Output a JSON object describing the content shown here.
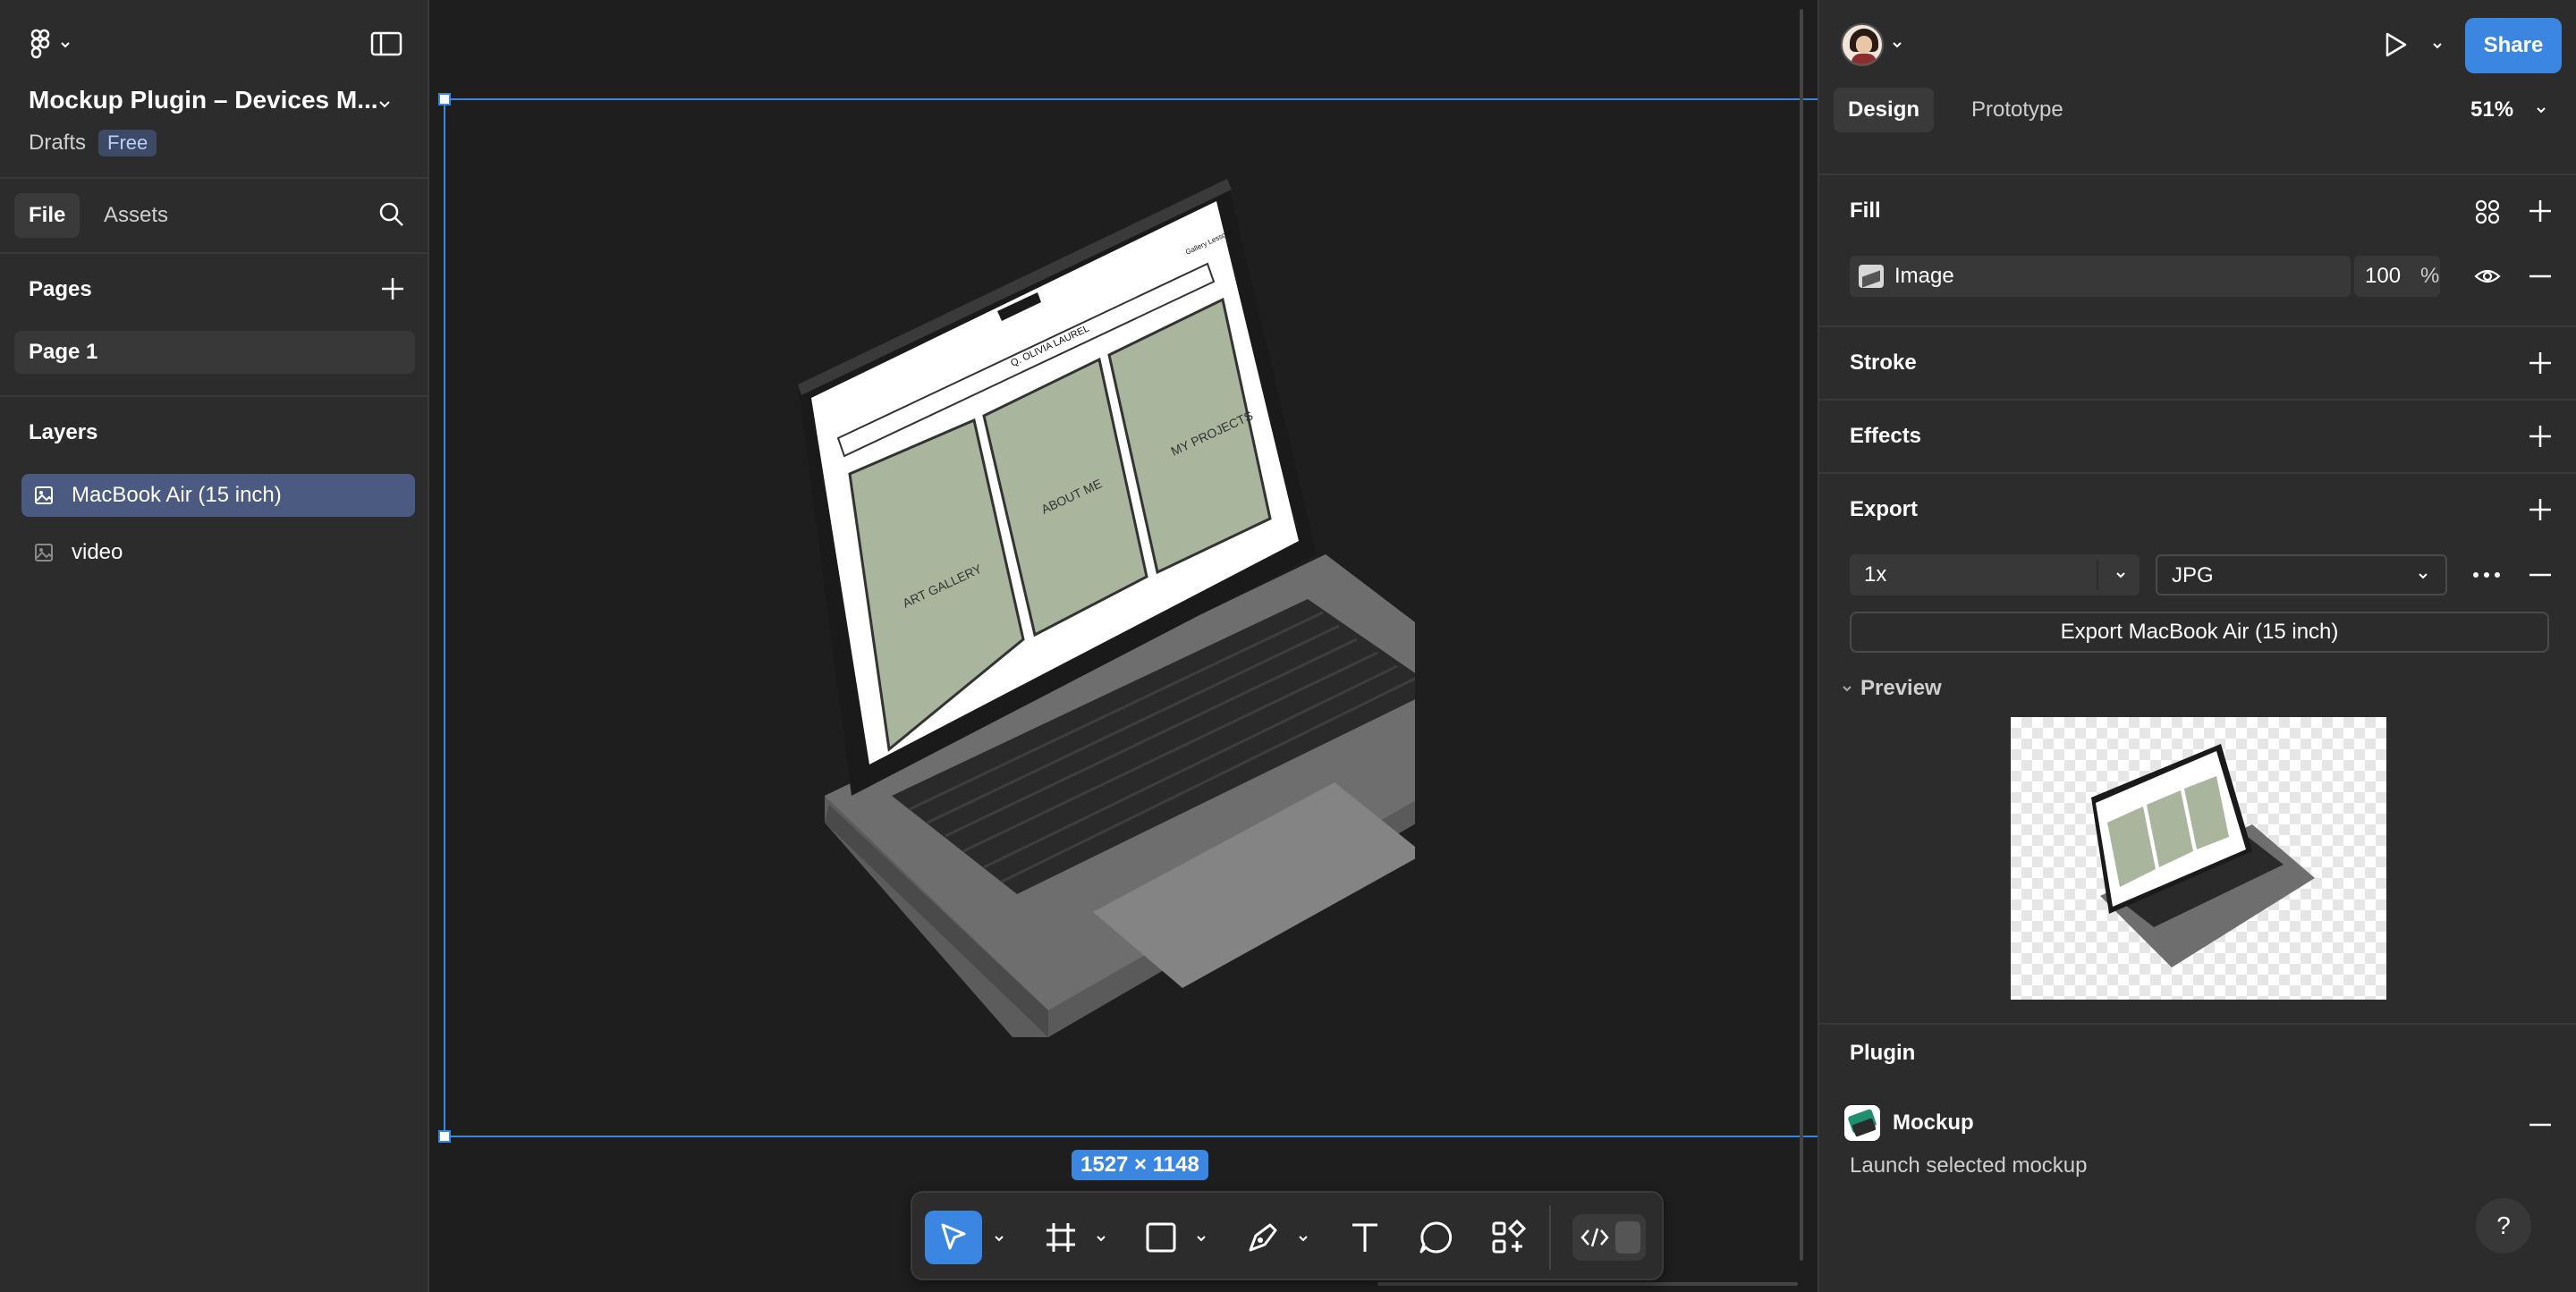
{
  "file": {
    "name": "Mockup Plugin – Devices M...",
    "location": "Drafts",
    "plan_badge": "Free"
  },
  "left_tabs": [
    "File",
    "Assets"
  ],
  "pages": {
    "title": "Pages",
    "items": [
      "Page 1"
    ]
  },
  "layers": {
    "title": "Layers",
    "items": [
      "MacBook Air (15 inch)",
      "video"
    ]
  },
  "canvas": {
    "dimension_label": "1527 × 1148",
    "screen_texts": {
      "header": "Q. OLIVIA LAUREL",
      "nav": "Gallery   Lessons",
      "card_1": "ART GALLERY",
      "card_2": "ABOUT ME",
      "card_3": "MY PROJECTS"
    }
  },
  "topbar": {
    "share_label": "Share",
    "tabs": [
      "Design",
      "Prototype"
    ],
    "zoom": "51%"
  },
  "design": {
    "fill": {
      "title": "Fill",
      "type": "Image",
      "opacity": "100",
      "unit": "%"
    },
    "stroke": {
      "title": "Stroke"
    },
    "effects": {
      "title": "Effects"
    },
    "export": {
      "title": "Export",
      "scale": "1x",
      "format": "JPG",
      "button_label": "Export MacBook Air (15 inch)",
      "preview_label": "Preview"
    },
    "plugin": {
      "title": "Plugin",
      "name": "Mockup",
      "description": "Launch selected mockup"
    }
  },
  "help_label": "?",
  "colors": {
    "accent": "#0d99ff",
    "share_button": "#3a86e0",
    "selection": "#3a86e0",
    "screen_card": "#a9b59c",
    "panel_bg": "#2c2c2c",
    "canvas_bg": "#1e1e1e"
  }
}
